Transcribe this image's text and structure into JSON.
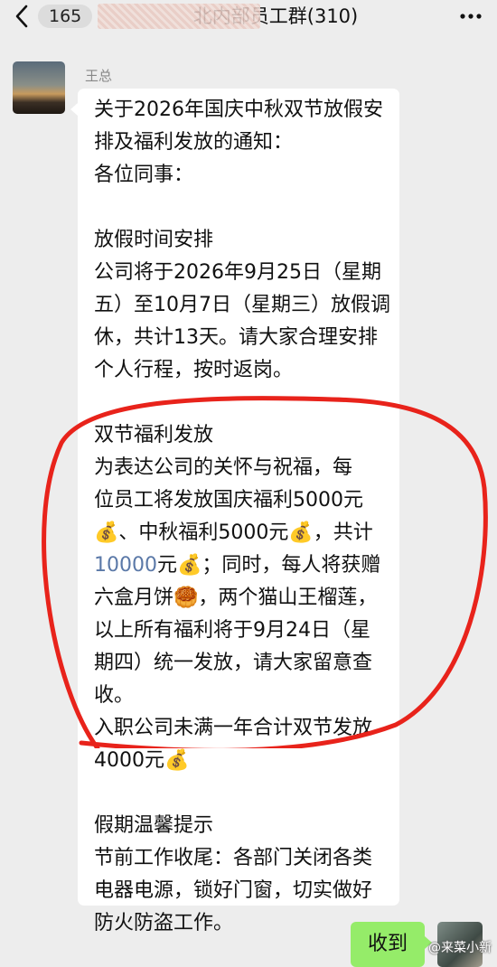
{
  "header": {
    "back_icon": "chevron-left-icon",
    "unread_count": "165",
    "title_visible": "北内部员工群(310)",
    "more_icon": "more-dots-icon"
  },
  "message": {
    "sender": "王总",
    "lines": [
      "关于2026年国庆中秋双节放假安",
      "排及福利发放的通知：",
      "各位同事：",
      "",
      "放假时间安排",
      "公司将于2026年9月25日（星期",
      "五）至10月7日（星期三）放假调",
      "休，共计13天。请大家合理安排",
      "个人行程，按时返岗。",
      "",
      "双节福利发放",
      "为表达公司的关怀与祝福，每",
      "位员工将发放国庆福利5000元",
      "💰、中秋福利5000元💰，共计",
      "10000元💰；同时，每人将获赠",
      "六盒月饼🥮，两个猫山王榴莲，",
      "以上所有福利将于9月24日（星",
      "期四）统一发放，请大家留意查",
      "收。",
      "入职公司未满一年合计双节发放",
      "4000元💰",
      "",
      "假期温馨提示",
      "节前工作收尾：各部门关闭各类",
      "电器电源，锁好门窗，切实做好",
      "防火防盗工作。"
    ]
  },
  "reply": {
    "text": "收到"
  },
  "watermark": "@来菜小新",
  "colors": {
    "background": "#ededed",
    "bubble": "#ffffff",
    "reply_bubble": "#95ec69",
    "highlight_circle": "#e8231b"
  }
}
